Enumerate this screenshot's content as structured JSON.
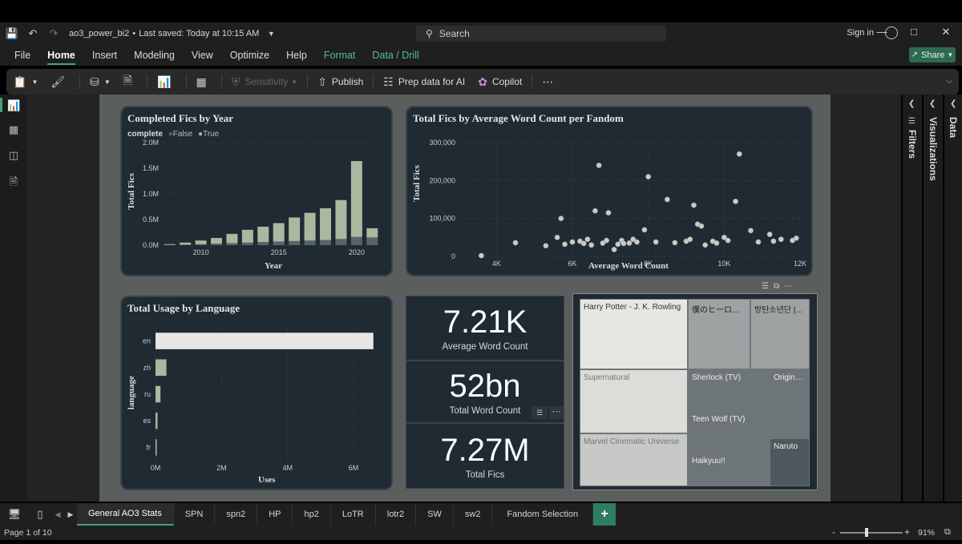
{
  "window": {
    "file_name": "ao3_power_bi2",
    "saved_status": "Last saved: Today at 10:15 AM",
    "search_label": "Search",
    "sign_in": "Sign in"
  },
  "menu": {
    "items": [
      "File",
      "Home",
      "Insert",
      "Modeling",
      "View",
      "Optimize",
      "Help",
      "Format",
      "Data / Drill"
    ],
    "share_label": "Share"
  },
  "ribbon": {
    "sensitivity": "Sensitivity",
    "publish": "Publish",
    "prep_data": "Prep data for AI",
    "copilot": "Copilot"
  },
  "right_panes": {
    "filters": "Filters",
    "visualizations": "Visualizations",
    "data": "Data"
  },
  "visuals": {
    "completed_by_year": {
      "title": "Completed Fics by Year",
      "legend_title": "complete",
      "legend_false": "False",
      "legend_true": "True",
      "ylabel": "Total Fics",
      "xlabel": "Year"
    },
    "scatter": {
      "title": "Total Fics by Average Word Count per Fandom",
      "ylabel": "Total Fics",
      "xlabel": "Average Word Count"
    },
    "language": {
      "title": "Total Usage by Language",
      "ylabel": "language",
      "xlabel": "Uses"
    },
    "kpi": [
      {
        "value": "7.21K",
        "label": "Average Word Count"
      },
      {
        "value": "52bn",
        "label": "Total Word Count"
      },
      {
        "value": "7.27M",
        "label": "Total Fics"
      }
    ],
    "treemap": [
      {
        "label": "Harry Potter - J. K. Rowling",
        "color": "#e6e7e3",
        "text": "#333"
      },
      {
        "label": "僕のヒーローアカデミア",
        "color": "#9ea2a2",
        "text": "#222"
      },
      {
        "label": "방탄소년단 | Bangtan Boys",
        "color": "#9ea2a2",
        "text": "#222"
      },
      {
        "label": "Supernatural",
        "color": "#dcdcd8",
        "text": "#777"
      },
      {
        "label": "Sherlock (TV)",
        "color": "#6e7578",
        "text": "#eee"
      },
      {
        "label": "Original Work",
        "color": "#6e7578",
        "text": "#eee"
      },
      {
        "label": "Teen Wolf (TV)",
        "color": "#6e7578",
        "text": "#eee"
      },
      {
        "label": "Marvel Cinematic Universe",
        "color": "#c6c9c5",
        "text": "#777"
      },
      {
        "label": "Haikyuu!!",
        "color": "#6e7578",
        "text": "#eee"
      },
      {
        "label": "Naruto",
        "color": "#4f585d",
        "text": "#eee"
      }
    ]
  },
  "tabs": [
    "General AO3 Stats",
    "SPN",
    "spn2",
    "HP",
    "hp2",
    "LoTR",
    "lotr2",
    "SW",
    "sw2",
    "Fandom Selection"
  ],
  "status": {
    "page": "Page 1 of 10",
    "zoom": "91%"
  },
  "chart_data": [
    {
      "type": "bar",
      "title": "Completed Fics by Year",
      "xlabel": "Year",
      "ylabel": "Total Fics",
      "x": [
        2008,
        2009,
        2010,
        2011,
        2012,
        2013,
        2014,
        2015,
        2016,
        2017,
        2018,
        2019,
        2020,
        2021
      ],
      "series": [
        {
          "name": "False",
          "values": [
            5000,
            10000,
            20000,
            30000,
            40000,
            50000,
            60000,
            70000,
            80000,
            90000,
            100000,
            120000,
            160000,
            150000
          ]
        },
        {
          "name": "True",
          "values": [
            15000,
            40000,
            70000,
            110000,
            180000,
            250000,
            300000,
            360000,
            460000,
            540000,
            620000,
            760000,
            1480000,
            180000
          ]
        }
      ],
      "stacked": true,
      "ylim": [
        0,
        2000000
      ],
      "yticks": [
        "0.0M",
        "0.5M",
        "1.0M",
        "1.5M",
        "2.0M"
      ],
      "xticks": [
        "2010",
        "2015",
        "2020"
      ]
    },
    {
      "type": "scatter",
      "title": "Total Fics by Average Word Count per Fandom",
      "xlabel": "Average Word Count",
      "ylabel": "Total Fics",
      "xlim": [
        3000,
        12000
      ],
      "ylim": [
        0,
        300000
      ],
      "xticks": [
        "4K",
        "6K",
        "8K",
        "10K",
        "12K"
      ],
      "yticks": [
        "0",
        "100,000",
        "200,000",
        "300,000"
      ],
      "points": [
        [
          3600,
          2000
        ],
        [
          4500,
          36000
        ],
        [
          5300,
          28000
        ],
        [
          5600,
          50000
        ],
        [
          5800,
          32000
        ],
        [
          5700,
          100000
        ],
        [
          6000,
          38000
        ],
        [
          6200,
          40000
        ],
        [
          6300,
          34000
        ],
        [
          6400,
          45000
        ],
        [
          6500,
          30000
        ],
        [
          6600,
          120000
        ],
        [
          6800,
          35000
        ],
        [
          6700,
          240000
        ],
        [
          6900,
          42000
        ],
        [
          6950,
          115000
        ],
        [
          7100,
          18000
        ],
        [
          7200,
          32000
        ],
        [
          7300,
          42000
        ],
        [
          7350,
          34000
        ],
        [
          7500,
          35000
        ],
        [
          7600,
          45000
        ],
        [
          7700,
          38000
        ],
        [
          7900,
          70000
        ],
        [
          8000,
          210000
        ],
        [
          8200,
          38000
        ],
        [
          8500,
          150000
        ],
        [
          8700,
          36000
        ],
        [
          9000,
          40000
        ],
        [
          9100,
          45000
        ],
        [
          9200,
          135000
        ],
        [
          9300,
          85000
        ],
        [
          9400,
          80000
        ],
        [
          9500,
          30000
        ],
        [
          9700,
          40000
        ],
        [
          9800,
          35000
        ],
        [
          10000,
          50000
        ],
        [
          10100,
          42000
        ],
        [
          10300,
          145000
        ],
        [
          10400,
          270000
        ],
        [
          10700,
          68000
        ],
        [
          10900,
          38000
        ],
        [
          11200,
          58000
        ],
        [
          11300,
          40000
        ],
        [
          11500,
          45000
        ],
        [
          11800,
          42000
        ],
        [
          11900,
          48000
        ]
      ]
    },
    {
      "type": "bar",
      "orientation": "horizontal",
      "title": "Total Usage by Language",
      "xlabel": "Uses",
      "ylabel": "language",
      "categories": [
        "en",
        "zh",
        "ru",
        "es",
        "fr"
      ],
      "values": [
        6600000,
        330000,
        150000,
        60000,
        30000
      ],
      "xlim": [
        0,
        6800000
      ],
      "xticks": [
        "0M",
        "2M",
        "4M",
        "6M"
      ]
    },
    {
      "type": "table",
      "title": "",
      "treemap": true,
      "categories": [
        "Harry Potter - J. K. Rowling",
        "僕のヒーローアカデミア",
        "방탄소년단 | Bangtan Boys",
        "Supernatural",
        "Sherlock (TV)",
        "Original Work",
        "Teen Wolf (TV)",
        "Marvel Cinematic Universe",
        "Haikyuu!!",
        "Naruto"
      ]
    }
  ]
}
